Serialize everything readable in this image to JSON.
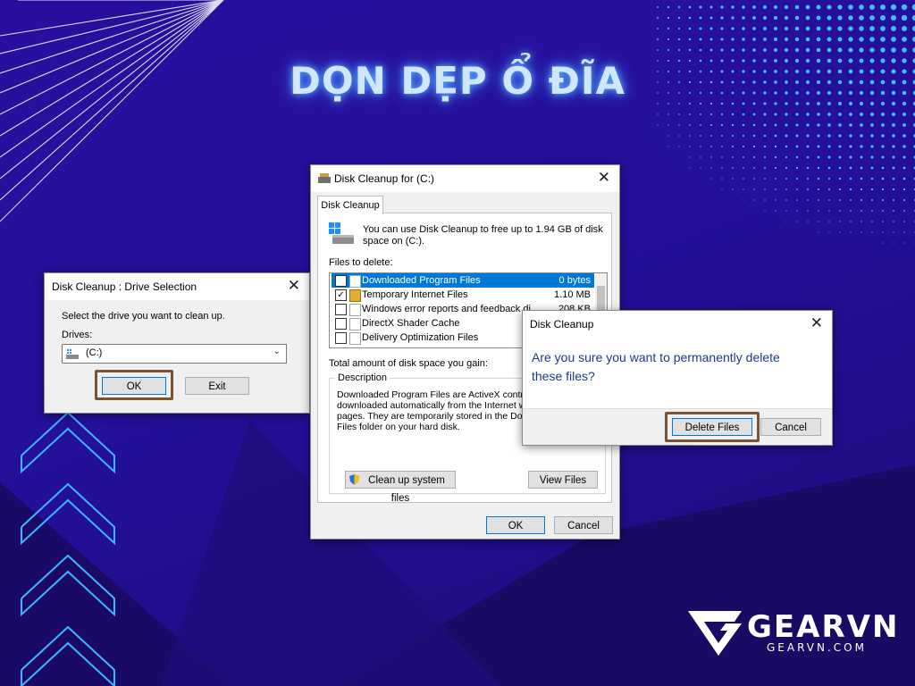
{
  "headline": "DỌN DẸP Ổ ĐĨA",
  "drive_dialog": {
    "title": "Disk Cleanup : Drive Selection",
    "prompt": "Select the drive you want to clean up.",
    "drives_label": "Drives:",
    "selected_drive": "(C:)",
    "ok_label": "OK",
    "exit_label": "Exit"
  },
  "cleanup_dialog": {
    "title": "Disk Cleanup for  (C:)",
    "tab_label": "Disk Cleanup",
    "intro": "You can use Disk Cleanup to free up to 1.94 GB of disk space on  (C:).",
    "files_label": "Files to delete:",
    "files": [
      {
        "name": "Downloaded Program Files",
        "size": "0 bytes",
        "checked": true,
        "selected": true
      },
      {
        "name": "Temporary Internet Files",
        "size": "1.10 MB",
        "checked": true,
        "selected": false
      },
      {
        "name": "Windows error reports and feedback di...",
        "size": "208 KB",
        "checked": false,
        "selected": false
      },
      {
        "name": "DirectX Shader Cache",
        "size": "",
        "checked": false,
        "selected": false
      },
      {
        "name": "Delivery Optimization Files",
        "size": "",
        "checked": false,
        "selected": false
      }
    ],
    "total_label": "Total amount of disk space you gain:",
    "description_label": "Description",
    "description_lines": [
      "Downloaded Program Files are ActiveX controls",
      "downloaded automatically from the Internet whe",
      "pages. They are temporarily stored in the Downl",
      "Files folder on your hard disk."
    ],
    "cleanup_system_label": "Clean up system files",
    "view_files_label": "View Files",
    "ok_label": "OK",
    "cancel_label": "Cancel"
  },
  "confirm_dialog": {
    "title": "Disk Cleanup",
    "message_line1": "Are you sure you want to permanently delete",
    "message_line2": "these files?",
    "delete_label": "Delete Files",
    "cancel_label": "Cancel"
  },
  "brand": {
    "name": "GEARVN",
    "site": "GEARVN.COM"
  },
  "colors": {
    "background": "#24109a",
    "title_glow": "#5fb2ff",
    "highlight_frame": "#7a5234",
    "selection": "#0078d7",
    "message_blue": "#1c3a8c"
  }
}
